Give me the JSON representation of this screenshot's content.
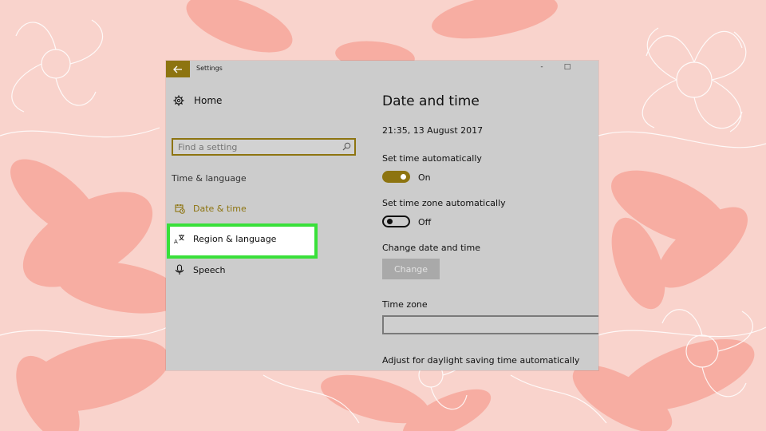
{
  "window": {
    "title": "Settings",
    "controls": {
      "minimize": "-",
      "maximize": "□"
    }
  },
  "sidebar": {
    "home_label": "Home",
    "search_placeholder": "Find a setting",
    "section_label": "Time & language",
    "items": [
      {
        "label": "Date & time",
        "icon": "date-time-icon",
        "active": true
      },
      {
        "label": "Region & language",
        "icon": "region-language-icon",
        "highlighted": true
      },
      {
        "label": "Speech",
        "icon": "microphone-icon"
      }
    ]
  },
  "main": {
    "title": "Date and time",
    "current_datetime": "21:35, 13 August 2017",
    "set_time_auto": {
      "label": "Set time automatically",
      "state": "On"
    },
    "set_timezone_auto": {
      "label": "Set time zone automatically",
      "state": "Off"
    },
    "change_date": {
      "label": "Change date and time",
      "button": "Change"
    },
    "time_zone": {
      "label": "Time zone",
      "value": ""
    },
    "daylight_label": "Adjust for daylight saving time automatically"
  },
  "colors": {
    "accent": "#8d7410",
    "highlight_border": "#39e03a",
    "window_bg": "#cccccc",
    "background": "#f9d3cc"
  }
}
